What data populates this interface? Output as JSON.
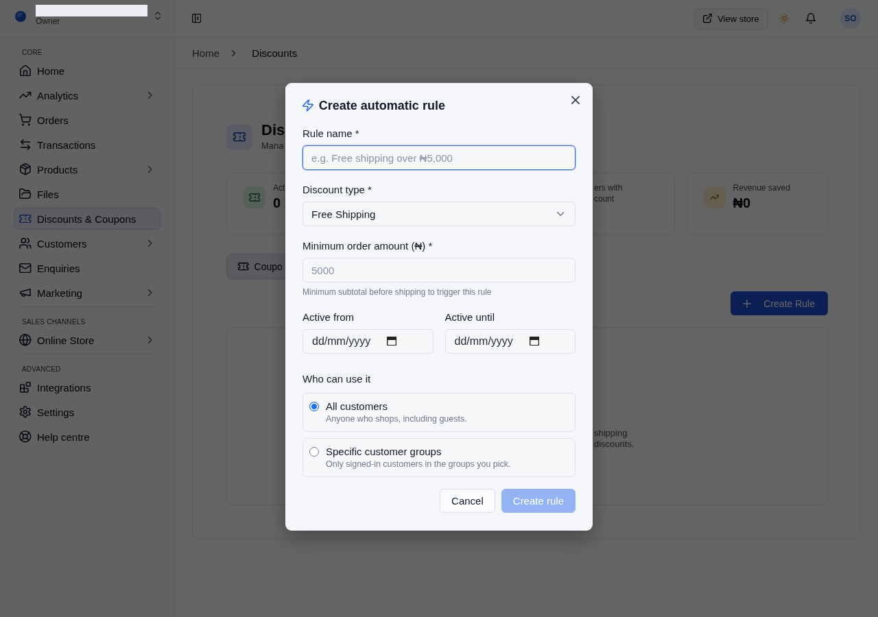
{
  "sidebar": {
    "account": {
      "role": "Owner"
    },
    "sections": [
      {
        "label": "CORE",
        "items": [
          {
            "label": "Home",
            "selected": false,
            "has_submenu": false
          },
          {
            "label": "Analytics",
            "selected": false,
            "has_submenu": true
          },
          {
            "label": "Orders",
            "selected": false,
            "has_submenu": false
          },
          {
            "label": "Transactions",
            "selected": false,
            "has_submenu": false
          },
          {
            "label": "Products",
            "selected": false,
            "has_submenu": true
          },
          {
            "label": "Files",
            "selected": false,
            "has_submenu": false
          },
          {
            "label": "Discounts & Coupons",
            "selected": true,
            "has_submenu": false
          },
          {
            "label": "Customers",
            "selected": false,
            "has_submenu": true
          },
          {
            "label": "Enquiries",
            "selected": false,
            "has_submenu": false
          },
          {
            "label": "Marketing",
            "selected": false,
            "has_submenu": true
          }
        ]
      },
      {
        "label": "SALES CHANNELS",
        "items": [
          {
            "label": "Online Store",
            "selected": false,
            "has_submenu": true
          }
        ]
      },
      {
        "label": "ADVANCED",
        "items": [
          {
            "label": "Integrations",
            "selected": false,
            "has_submenu": false
          },
          {
            "label": "Settings",
            "selected": false,
            "has_submenu": false
          },
          {
            "label": "Help centre",
            "selected": false,
            "has_submenu": false
          }
        ]
      }
    ]
  },
  "top_bar": {
    "view_store": "View store",
    "avatar": "SO"
  },
  "breadcrumb": [
    {
      "label": "Home",
      "current": false
    },
    {
      "label": "Discounts",
      "current": true
    }
  ],
  "page": {
    "title": "Dis",
    "subtitle": "Mana",
    "stats": [
      {
        "label": "Act",
        "value": "0"
      },
      {
        "label": "ers with count"
      },
      {
        "label": "Revenue saved",
        "value": "₦0"
      }
    ],
    "tabs": [
      {
        "label": "Coupo",
        "selected": true
      }
    ],
    "create_button": "Create Rule",
    "empty_text": "shipping discounts."
  },
  "modal": {
    "title": "Create automatic rule",
    "fields": [
      {
        "kind": "text",
        "label": "Rule name *",
        "placeholder": "e.g. Free shipping over ₦5,000",
        "focused": true
      },
      {
        "kind": "select",
        "label": "Discount type *",
        "value": "Free Shipping"
      },
      {
        "kind": "text",
        "label": "Minimum order amount (₦) *",
        "placeholder": "5000",
        "focused": false,
        "hint": "Minimum subtotal before shipping to trigger this rule"
      }
    ],
    "dates": [
      {
        "label": "Active from",
        "placeholder": "dd/mm/yyyy"
      },
      {
        "label": "Active until",
        "placeholder": "dd/mm/yyyy"
      }
    ],
    "audience": {
      "label": "Who can use it",
      "options": [
        {
          "title": "All customers",
          "description": "Anyone who shops, including guests.",
          "selected": true
        },
        {
          "title": "Specific customer groups",
          "description": "Only signed-in customers in the groups you pick.",
          "selected": false
        }
      ]
    },
    "buttons": [
      {
        "label": "Cancel",
        "kind": "secondary",
        "disabled": false
      },
      {
        "label": "Create rule",
        "kind": "primary",
        "disabled": true
      }
    ]
  }
}
